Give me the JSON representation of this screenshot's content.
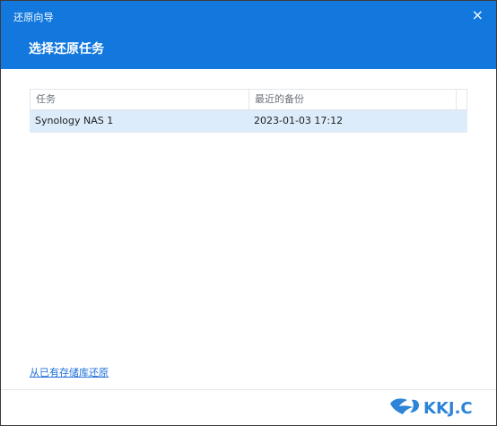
{
  "window": {
    "title": "还原向导",
    "close_glyph": "×"
  },
  "step": {
    "title": "选择还原任务"
  },
  "table": {
    "columns": [
      "任务",
      "最近的备份"
    ],
    "rows": [
      {
        "task": "Synology NAS 1",
        "last_backup": "2023-01-03 17:12"
      }
    ]
  },
  "footer": {
    "restore_link": "从已有存储库还原"
  },
  "colors": {
    "header": "#1278de",
    "selected_row": "#dcecfb",
    "link": "#1e6fd9"
  },
  "watermark": {
    "text": "KKJ.C",
    "icon": "watermark-logo-icon"
  }
}
